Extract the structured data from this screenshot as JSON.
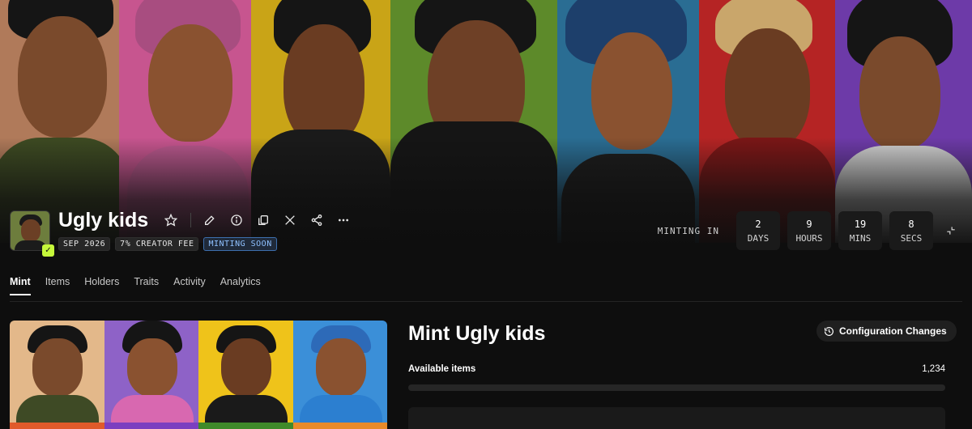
{
  "collection": {
    "title": "Ugly kids",
    "badges": {
      "date": "SEP 2026",
      "creator_fee": "7% CREATOR FEE",
      "status": "MINTING SOON"
    },
    "header_icons": [
      "star-icon",
      "edit-icon",
      "info-icon",
      "copy-icon",
      "x-icon",
      "share-icon",
      "more-icon"
    ]
  },
  "countdown": {
    "label": "MINTING IN",
    "days": {
      "value": "2",
      "unit": "DAYS"
    },
    "hours": {
      "value": "9",
      "unit": "HOURS"
    },
    "mins": {
      "value": "19",
      "unit": "MINS"
    },
    "secs": {
      "value": "8",
      "unit": "SECS"
    }
  },
  "tabs": [
    {
      "label": "Mint",
      "active": true
    },
    {
      "label": "Items",
      "active": false
    },
    {
      "label": "Holders",
      "active": false
    },
    {
      "label": "Traits",
      "active": false
    },
    {
      "label": "Activity",
      "active": false
    },
    {
      "label": "Analytics",
      "active": false
    }
  ],
  "mint": {
    "title": "Mint Ugly kids",
    "config_button": "Configuration Changes",
    "available_label": "Available items",
    "available_value": "1,234",
    "progress_fraction": 0
  },
  "colors": {
    "accent_status": "#8fc1ff",
    "verified": "#c5f73a",
    "background": "#0e0e0e"
  }
}
